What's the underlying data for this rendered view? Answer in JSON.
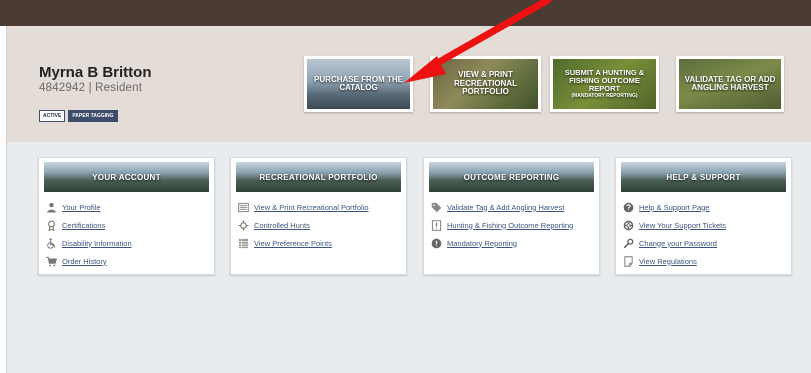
{
  "user": {
    "name": "Myrna B Britton",
    "id_line": "4842942  |  Resident",
    "badges": [
      "ACTIVE",
      "PAPER TAGGING"
    ]
  },
  "tiles": [
    {
      "label": "PURCHASE FROM THE CATALOG"
    },
    {
      "label": "VIEW & PRINT RECREATIONAL PORTFOLIO"
    },
    {
      "label": "SUBMIT A HUNTING & FISHING OUTCOME REPORT",
      "sub": "(MANDATORY REPORTING)"
    },
    {
      "label": "VALIDATE TAG OR ADD ANGLING HARVEST"
    }
  ],
  "annotation": {
    "arrow_color": "#ee1111"
  },
  "cards": [
    {
      "title": "YOUR ACCOUNT",
      "links": [
        {
          "icon": "person-icon",
          "label": "Your Profile"
        },
        {
          "icon": "certificate-icon",
          "label": "Certifications"
        },
        {
          "icon": "wheelchair-icon",
          "label": "Disability Information"
        },
        {
          "icon": "cart-icon",
          "label": "Order History"
        }
      ]
    },
    {
      "title": "RECREATIONAL PORTFOLIO",
      "links": [
        {
          "icon": "list-icon",
          "label": "View & Print Recreational Portfolio"
        },
        {
          "icon": "crosshair-icon",
          "label": "Controlled Hunts"
        },
        {
          "icon": "table-icon",
          "label": "View Preference Points"
        }
      ]
    },
    {
      "title": "OUTCOME REPORTING",
      "links": [
        {
          "icon": "tag-icon",
          "label": "Validate Tag & Add Angling Harvest"
        },
        {
          "icon": "report-icon",
          "label": "Hunting & Fishing Outcome Reporting"
        },
        {
          "icon": "alert-icon",
          "label": "Mandatory Reporting"
        }
      ]
    },
    {
      "title": "HELP & SUPPORT",
      "links": [
        {
          "icon": "question-icon",
          "label": "Help & Support Page"
        },
        {
          "icon": "lifebuoy-icon",
          "label": "View Your Support Tickets"
        },
        {
          "icon": "wrench-icon",
          "label": "Change your Password"
        },
        {
          "icon": "document-icon",
          "label": "View Regulations"
        }
      ]
    }
  ]
}
